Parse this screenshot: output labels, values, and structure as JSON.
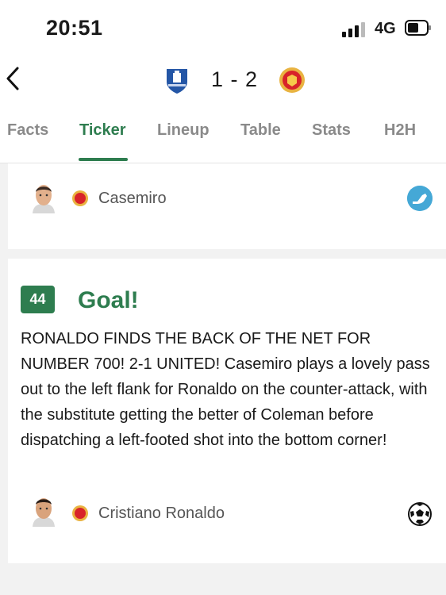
{
  "status": {
    "time": "20:51",
    "network": "4G"
  },
  "match": {
    "score": "1 - 2",
    "home_team": "Everton",
    "away_team": "Manchester United"
  },
  "tabs": [
    {
      "label": "Facts"
    },
    {
      "label": "Ticker"
    },
    {
      "label": "Lineup"
    },
    {
      "label": "Table"
    },
    {
      "label": "Stats"
    },
    {
      "label": "H2H"
    }
  ],
  "active_tab": "Ticker",
  "events": [
    {
      "player": "Casemiro",
      "icon": "boot-icon"
    },
    {
      "minute": "44",
      "title": "Goal!",
      "text": "RONALDO FINDS THE BACK OF THE NET FOR NUMBER 700! 2-1 UNITED! Casemiro plays a lovely pass out to the left flank for Ronaldo on the counter-attack, with the substitute getting the better of Coleman before dispatching a left-footed shot into the bottom corner!",
      "player": "Cristiano Ronaldo",
      "icon": "football-icon"
    }
  ],
  "colors": {
    "accent": "#2e7d4f",
    "boot": "#45a8d6"
  }
}
